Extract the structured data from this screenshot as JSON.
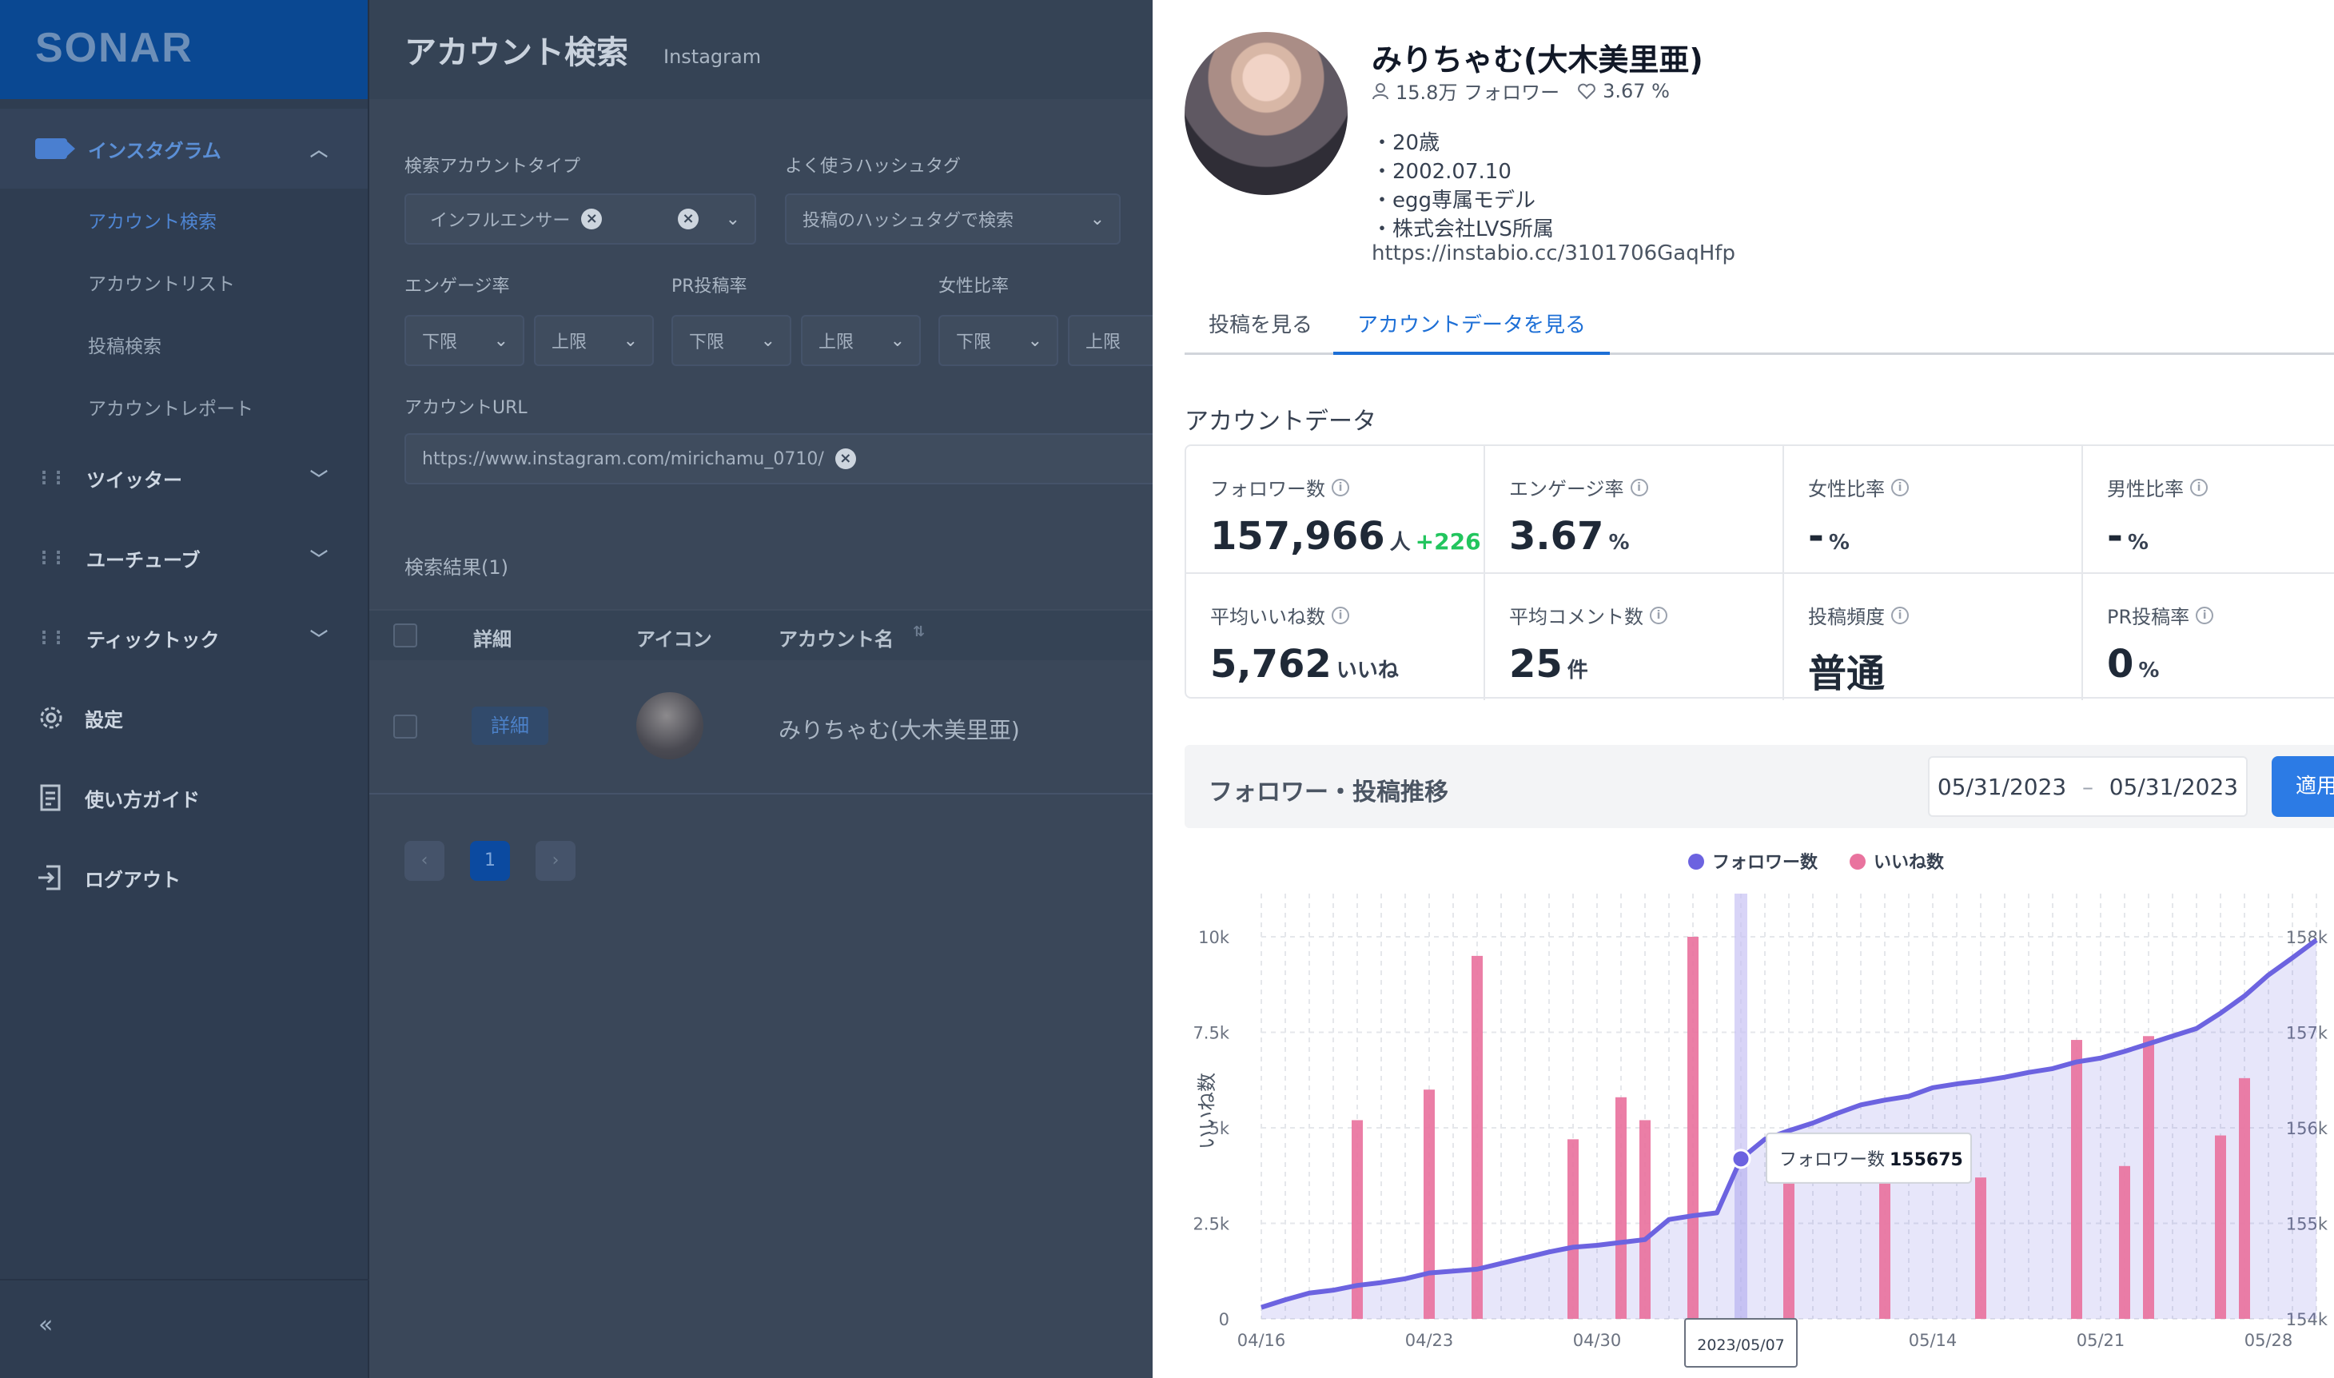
{
  "sidebar": {
    "logo": "SONAR",
    "instagram": {
      "label": "インスタグラム",
      "items": [
        "アカウント検索",
        "アカウントリスト",
        "投稿検索",
        "アカウントレポート"
      ]
    },
    "twitter": "ツイッター",
    "youtube": "ユーチューブ",
    "tiktok": "ティックトック",
    "settings": "設定",
    "guide": "使い方ガイド",
    "logout": "ログアウト",
    "collapse": "«"
  },
  "main": {
    "title": "アカウント検索",
    "subtitle": "Instagram",
    "account_type_label": "検索アカウントタイプ",
    "account_type_value": "インフルエンサー",
    "hashtag_label": "よく使うハッシュタグ",
    "hashtag_placeholder": "投稿のハッシュタグで検索",
    "engagement_label": "エンゲージ率",
    "pr_label": "PR投稿率",
    "female_label": "女性比率",
    "lower": "下限",
    "upper": "上限",
    "url_label": "アカウントURL",
    "url_value": "https://www.instagram.com/mirichamu_0710/",
    "results_label": "検索結果(1)",
    "columns": [
      "詳細",
      "アイコン",
      "アカウント名"
    ],
    "row": {
      "detail": "詳細",
      "name": "みりちゃむ(大木美里亜)"
    },
    "pagination": {
      "prev": "‹",
      "current": "1",
      "next": "›"
    }
  },
  "profile": {
    "name": "みりちゃむ(大木美里亜)",
    "followers": "15.8万 フォロワー",
    "engagement": "3.67 %",
    "bio": [
      "・20歳",
      "・2002.07.10",
      "・egg専属モデル",
      "・株式会社LVS所属",
      "https://instabio.cc/3101706GaqHfp"
    ],
    "tabs": [
      "投稿を見る",
      "アカウントデータを見る"
    ]
  },
  "account_data": {
    "title": "アカウントデータ",
    "stats": [
      {
        "label": "フォロワー数",
        "value": "157,966",
        "unit": "人",
        "delta": "+226"
      },
      {
        "label": "エンゲージ率",
        "value": "3.67",
        "unit": "%",
        "delta": ""
      },
      {
        "label": "女性比率",
        "value": "-",
        "unit": "%",
        "delta": ""
      },
      {
        "label": "男性比率",
        "value": "-",
        "unit": "%",
        "delta": ""
      },
      {
        "label": "平均いいね数",
        "value": "5,762",
        "unit": "いいね",
        "delta": ""
      },
      {
        "label": "平均コメント数",
        "value": "25",
        "unit": "件",
        "delta": ""
      },
      {
        "label": "投稿頻度",
        "value": "普通",
        "unit": "",
        "delta": ""
      },
      {
        "label": "PR投稿率",
        "value": "0",
        "unit": "%",
        "delta": ""
      }
    ]
  },
  "trend": {
    "title": "フォロワー・投稿推移",
    "date_from": "05/31/2023",
    "date_sep": "–",
    "date_to": "05/31/2023",
    "apply": "適用"
  },
  "colors": {
    "followers": "#6c63e0",
    "likes": "#e9739e",
    "accent": "#2c7be5"
  },
  "chart_data": {
    "type": "bar",
    "legend": [
      "フォロワー数",
      "いいね数"
    ],
    "legend_placement": "top-center",
    "x_ticks": [
      "04/16",
      "04/23",
      "04/30",
      "05/07",
      "05/14",
      "05/21",
      "05/28"
    ],
    "ylabel_left": "いいね数",
    "ylim_left": [
      0,
      10000
    ],
    "yticks_left": [
      "0",
      "2.5k",
      "5k",
      "7.5k",
      "10k"
    ],
    "ylim_right": [
      154000,
      158000
    ],
    "yticks_right": [
      "154k",
      "155k",
      "156k",
      "157k",
      "158k"
    ],
    "series": [
      {
        "name": "いいね数",
        "type": "bar",
        "axis": "left",
        "points": [
          [
            4,
            5200
          ],
          [
            7,
            6000
          ],
          [
            9,
            9500
          ],
          [
            13,
            4700
          ],
          [
            15,
            5800
          ],
          [
            16,
            5200
          ],
          [
            18,
            10000
          ],
          [
            22,
            3600
          ],
          [
            26,
            4000
          ],
          [
            30,
            3700
          ],
          [
            34,
            7300
          ],
          [
            36,
            4000
          ],
          [
            37,
            7400
          ],
          [
            40,
            4800
          ],
          [
            41,
            6300
          ]
        ]
      },
      {
        "name": "フォロワー数",
        "type": "line",
        "axis": "right",
        "points": [
          [
            0,
            154120
          ],
          [
            1,
            154200
          ],
          [
            2,
            154270
          ],
          [
            3,
            154300
          ],
          [
            4,
            154350
          ],
          [
            5,
            154380
          ],
          [
            6,
            154420
          ],
          [
            7,
            154480
          ],
          [
            8,
            154500
          ],
          [
            9,
            154520
          ],
          [
            10,
            154580
          ],
          [
            11,
            154640
          ],
          [
            12,
            154700
          ],
          [
            13,
            154750
          ],
          [
            14,
            154770
          ],
          [
            15,
            154800
          ],
          [
            16,
            154830
          ],
          [
            17,
            155040
          ],
          [
            18,
            155080
          ],
          [
            19,
            155110
          ],
          [
            20,
            155675
          ],
          [
            21,
            155880
          ],
          [
            22,
            155970
          ],
          [
            23,
            156050
          ],
          [
            24,
            156150
          ],
          [
            25,
            156240
          ],
          [
            26,
            156290
          ],
          [
            27,
            156330
          ],
          [
            28,
            156420
          ],
          [
            29,
            156460
          ],
          [
            30,
            156490
          ],
          [
            31,
            156530
          ],
          [
            32,
            156580
          ],
          [
            33,
            156620
          ],
          [
            34,
            156690
          ],
          [
            35,
            156730
          ],
          [
            36,
            156800
          ],
          [
            37,
            156880
          ],
          [
            38,
            156960
          ],
          [
            39,
            157040
          ],
          [
            40,
            157200
          ],
          [
            41,
            157380
          ],
          [
            42,
            157600
          ],
          [
            43,
            157780
          ],
          [
            44,
            157966
          ]
        ]
      }
    ],
    "tooltip": {
      "label": "フォロワー数",
      "value": "155675",
      "date": "2023/05/07",
      "index": 20
    }
  }
}
